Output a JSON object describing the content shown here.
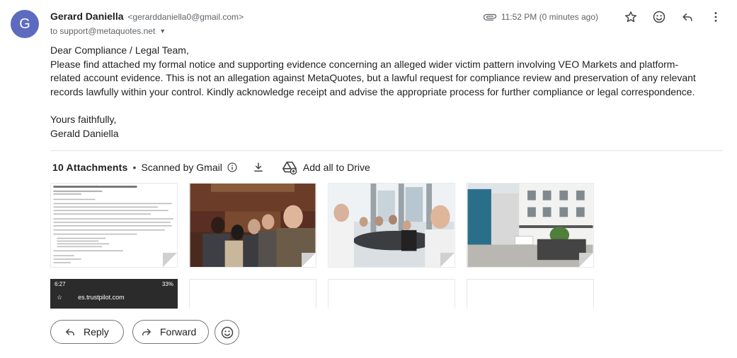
{
  "sender": {
    "avatar_letter": "G",
    "name": "Gerard Daniella",
    "email": "<gerarddaniella0@gmail.com>",
    "to_line": "to support@metaquotes.net"
  },
  "header": {
    "timestamp": "11:52 PM (0 minutes ago)",
    "icons": [
      "paperclip-icon",
      "star-icon",
      "emoji-icon",
      "reply-icon",
      "more-vert-icon"
    ]
  },
  "message": {
    "greeting": "Dear Compliance / Legal Team,",
    "paragraph": "Please find attached my formal notice and supporting evidence concerning an alleged wider victim pattern involving VEO Markets and platform-related account evidence. This is not an allegation against MetaQuotes, but a lawful request for compliance review and preservation of any relevant records lawfully within your control. Kindly acknowledge receipt and advise the appropriate process for further compliance or legal correspondence.",
    "signoff": "Yours faithfully,",
    "signature": "Gerald Daniella"
  },
  "attachments": {
    "count_label": "10 Attachments",
    "separator": "•",
    "scanned_label": "Scanned by Gmail",
    "add_drive_label": "Add all to Drive",
    "phone_thumb": {
      "time": "6:27",
      "battery": "33%",
      "url": "es.trustpilot.com"
    }
  },
  "actions": {
    "reply_label": "Reply",
    "forward_label": "Forward"
  },
  "colors": {
    "avatar_bg": "#5c6bc0",
    "text_primary": "#202124",
    "text_secondary": "#5f6368",
    "border": "#747775"
  }
}
